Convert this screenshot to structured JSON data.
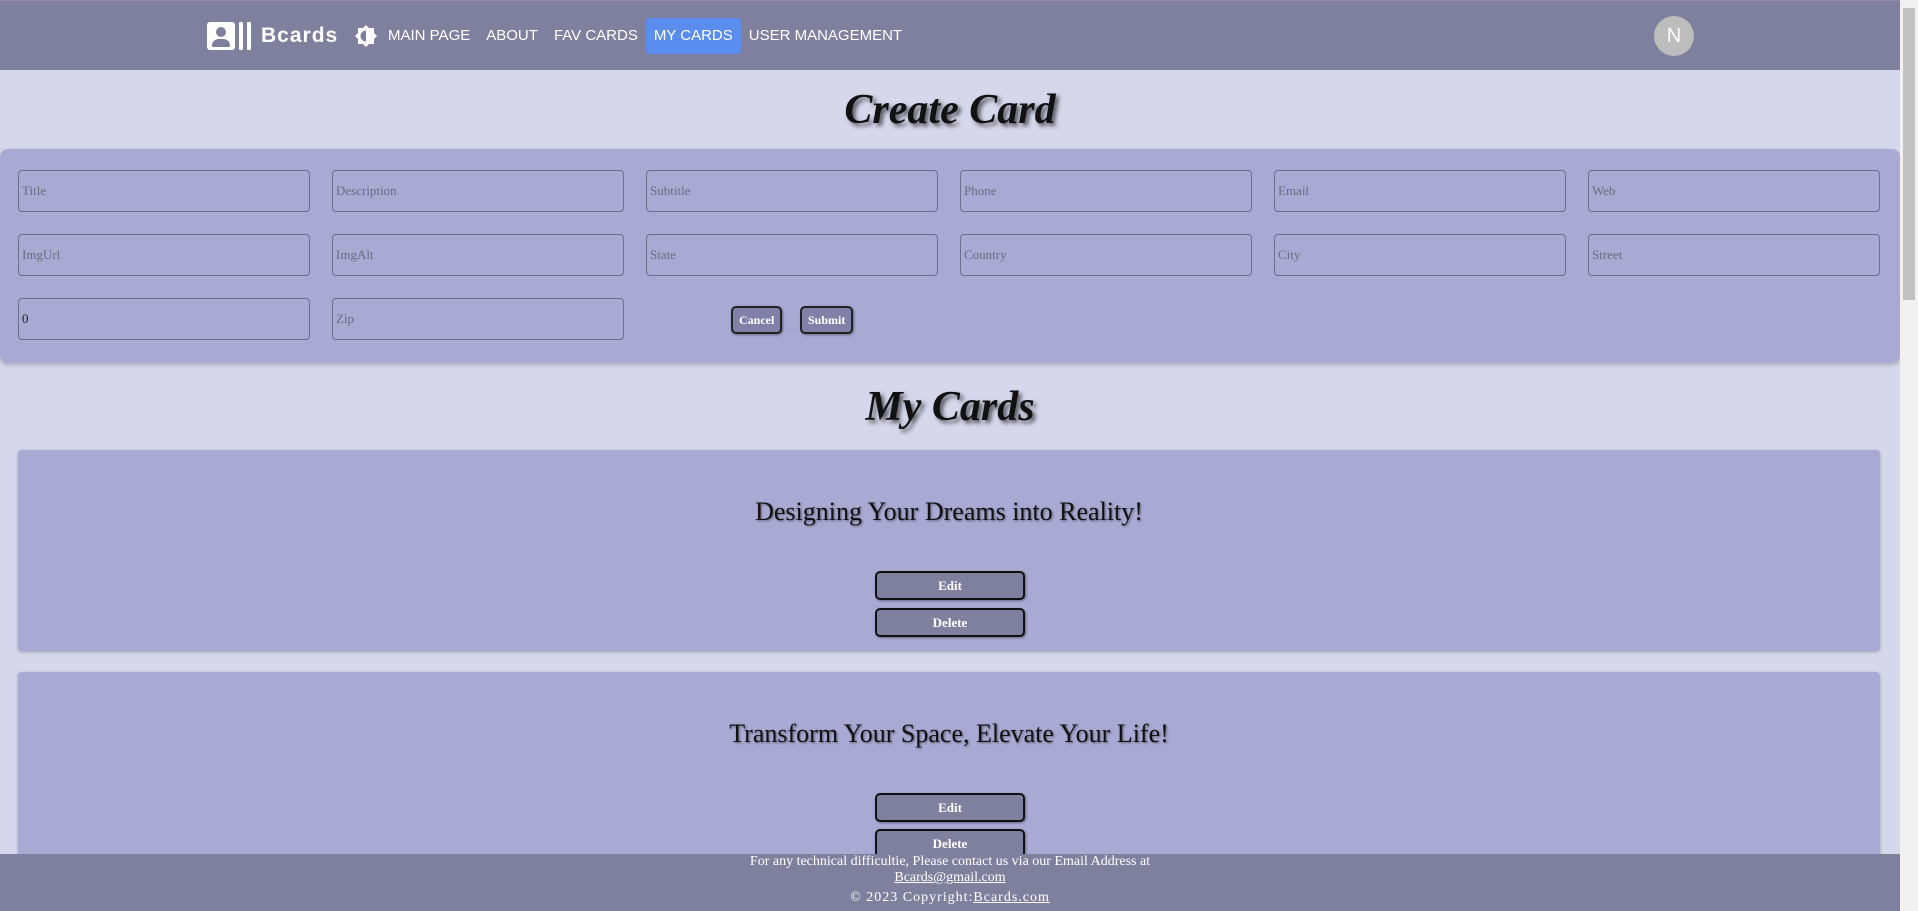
{
  "brand": {
    "name": "Bcards"
  },
  "nav": {
    "items": [
      {
        "label": "MAIN PAGE"
      },
      {
        "label": "ABOUT"
      },
      {
        "label": "FAV CARDS"
      },
      {
        "label": "MY CARDS",
        "active": true
      },
      {
        "label": "USER MANAGEMENT"
      }
    ]
  },
  "user": {
    "avatar_initial": "N"
  },
  "create_card": {
    "title": "Create Card",
    "placeholders": {
      "title": "Title",
      "description": "Description",
      "subtitle": "Subtitle",
      "phone": "Phone",
      "email": "Email",
      "web": "Web",
      "img_url": "ImgUrl",
      "img_alt": "ImgAlt",
      "state": "State",
      "country": "Country",
      "city": "City",
      "street": "Street",
      "zip": "Zip"
    },
    "values": {
      "house_number": "0"
    },
    "cancel_label": "Cancel",
    "submit_label": "Submit"
  },
  "my_cards": {
    "title": "My Cards",
    "cards": [
      {
        "title": "Designing Your Dreams into Reality!",
        "edit_label": "Edit",
        "delete_label": "Delete"
      },
      {
        "title": "Transform Your Space, Elevate Your Life!",
        "edit_label": "Edit",
        "delete_label": "Delete"
      }
    ]
  },
  "footer": {
    "contact_text": "For any technical difficultie, Please contact us via our Email Address at",
    "email": "Bcards@gmail.com",
    "copyright_prefix": "© 2023 Copyright:",
    "site": "Bcards.com"
  },
  "colors": {
    "appbar": "#7f809e",
    "background": "#d6d7eb",
    "panel": "#a9a9d3",
    "active_nav": "#5b8def"
  }
}
